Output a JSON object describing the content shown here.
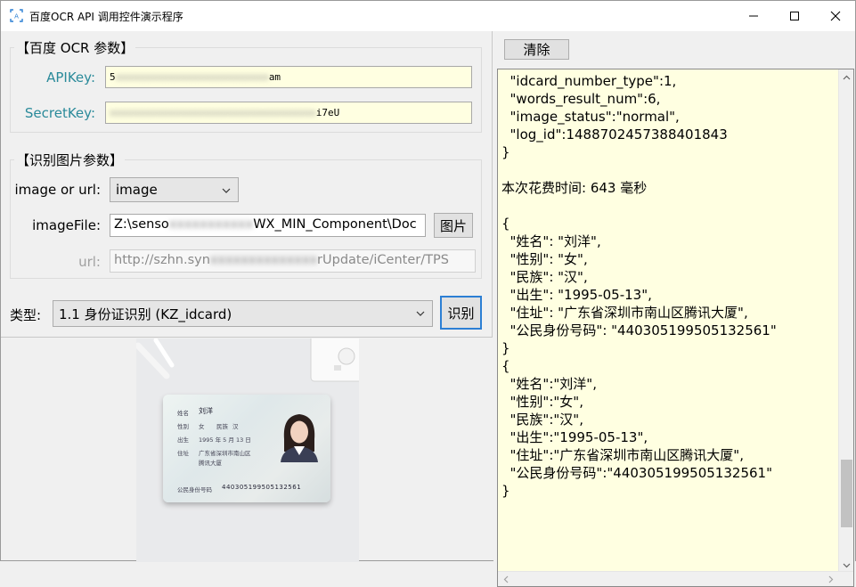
{
  "window": {
    "title": "百度OCR API 调用控件演示程序"
  },
  "ocr_params": {
    "group_title": "【百度 OCR 参数】",
    "apikey_label": "APIKey:",
    "apikey_value_start": "5",
    "apikey_value_end": "am",
    "secretkey_label": "SecretKey:",
    "secretkey_value_end": "i7eU"
  },
  "image_params": {
    "group_title": "【识别图片参数】",
    "image_or_url_label": "image or url:",
    "image_or_url_value": "image",
    "imagefile_label": "imageFile:",
    "imagefile_value_start": "Z:\\senso",
    "imagefile_value_end": "WX_MIN_Component\\Doc",
    "picture_button": "图片",
    "url_label": "url:",
    "url_value_start": "http://szhn.syn",
    "url_value_end": "rUpdate/iCenter/TPS"
  },
  "type_row": {
    "label": "类型:",
    "value": "1.1 身份证识别 (KZ_idcard)",
    "recognize_button": "识别"
  },
  "id_card": {
    "name_label": "姓名",
    "name": "刘洋",
    "gender_label": "性别",
    "gender": "女",
    "ethnicity_label": "民族",
    "ethnicity": "汉",
    "birth_label": "出生",
    "birth": "1995 年 5 月 13 日",
    "address_label": "住址",
    "address_line1": "广东省深圳市南山区",
    "address_line2": "腾讯大厦",
    "id_label": "公民身份号码",
    "id_number": "440305199505132561"
  },
  "output": {
    "clear_button": "清除",
    "text": "  \"idcard_number_type\":1,\n  \"words_result_num\":6,\n  \"image_status\":\"normal\",\n  \"log_id\":1488702457388401843\n}\n\n本次花费时间: 643 毫秒\n\n{\n  \"姓名\": \"刘洋\",\n  \"性别\": \"女\",\n  \"民族\": \"汉\",\n  \"出生\": \"1995-05-13\",\n  \"住址\": \"广东省深圳市南山区腾讯大厦\",\n  \"公民身份号码\": \"440305199505132561\"\n}\n{\n  \"姓名\":\"刘洋\",\n  \"性别\":\"女\",\n  \"民族\":\"汉\",\n  \"出生\":\"1995-05-13\",\n  \"住址\":\"广东省深圳市南山区腾讯大厦\",\n  \"公民身份号码\":\"440305199505132561\"\n}"
  },
  "icons": {
    "app": "ocr-scan-icon",
    "minimize": "minimize-icon",
    "maximize": "maximize-icon",
    "close": "close-icon",
    "dropdown": "chevron-down-icon"
  }
}
